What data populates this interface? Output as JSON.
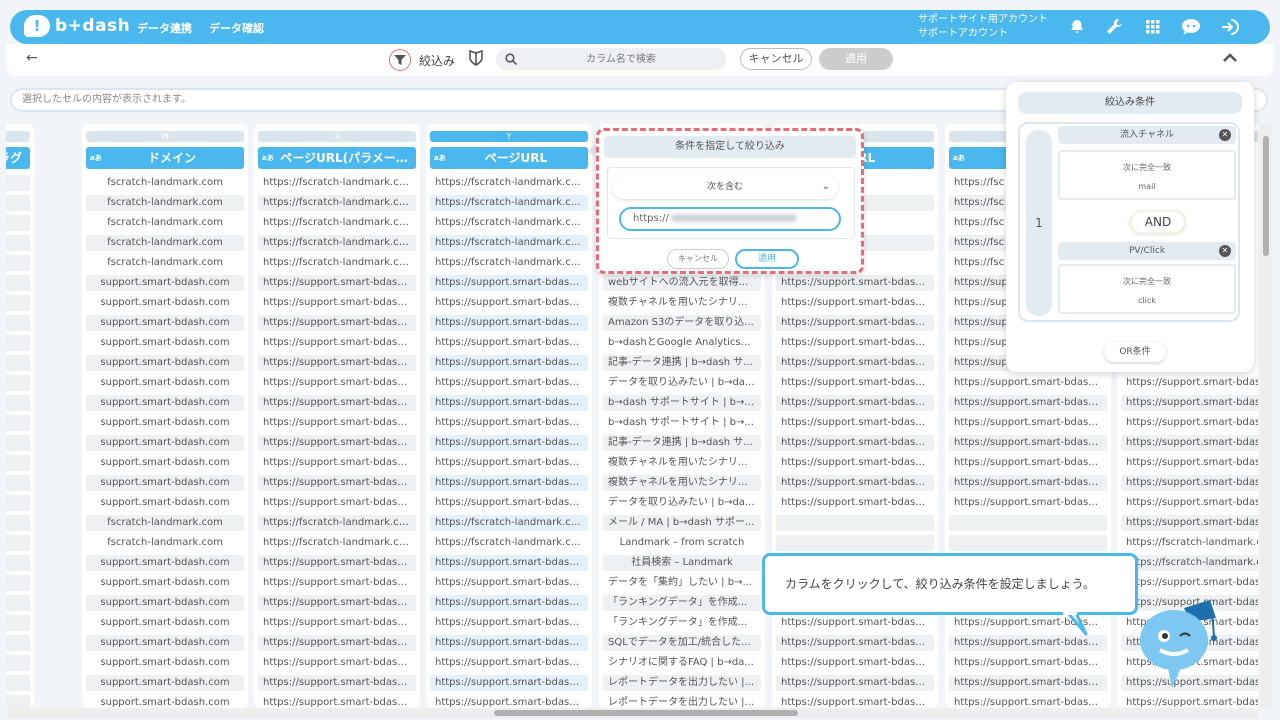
{
  "header": {
    "logo_text": "b+dash",
    "nav": [
      "データ連携",
      "データ確認"
    ],
    "account_line1": "サポートサイト用アカウント",
    "account_line2": "サポートアカウント",
    "icons": [
      "bell-icon",
      "wrench-icon",
      "grid-icon",
      "chat-icon",
      "logout-icon"
    ],
    "accent_color": "#4ab8ee"
  },
  "toolbar": {
    "back_icon": "←",
    "filter_label": "絞込み",
    "search_placeholder": "カラム名で検索",
    "cancel_label": "キャンセル",
    "apply_label": "適用"
  },
  "cell_display": {
    "placeholder": "選択したセルの内容が表示されます。"
  },
  "grid": {
    "columns": [
      {
        "letter": "",
        "header": "フラグ",
        "cells": [
          "",
          "",
          "",
          "",
          "",
          "",
          "",
          "",
          "",
          "",
          "",
          "",
          "",
          "",
          "",
          "",
          "",
          "",
          "",
          "",
          "",
          "",
          "",
          "",
          "",
          "",
          ""
        ]
      },
      {
        "letter": "W",
        "header": "ドメイン",
        "cells": [
          "fscratch-landmark.com",
          "fscratch-landmark.com",
          "fscratch-landmark.com",
          "fscratch-landmark.com",
          "fscratch-landmark.com",
          "support.smart-bdash.com",
          "support.smart-bdash.com",
          "support.smart-bdash.com",
          "support.smart-bdash.com",
          "support.smart-bdash.com",
          "support.smart-bdash.com",
          "support.smart-bdash.com",
          "support.smart-bdash.com",
          "support.smart-bdash.com",
          "support.smart-bdash.com",
          "support.smart-bdash.com",
          "support.smart-bdash.com",
          "fscratch-landmark.com",
          "fscratch-landmark.com",
          "support.smart-bdash.com",
          "support.smart-bdash.com",
          "support.smart-bdash.com",
          "support.smart-bdash.com",
          "support.smart-bdash.com",
          "support.smart-bdash.com",
          "support.smart-bdash.com",
          "support.smart-bdash.com"
        ]
      },
      {
        "letter": "X",
        "header": "ページURL(パラメー…",
        "cells": [
          "https://fscratch-landmark.co...",
          "https://fscratch-landmark.co...",
          "https://fscratch-landmark.co...",
          "https://fscratch-landmark.co...",
          "https://fscratch-landmark.co...",
          "https://support.smart-bdash...",
          "https://support.smart-bdash...",
          "https://support.smart-bdash...",
          "https://support.smart-bdash...",
          "https://support.smart-bdash...",
          "https://support.smart-bdash...",
          "https://support.smart-bdash...",
          "https://support.smart-bdash...",
          "https://support.smart-bdash...",
          "https://support.smart-bdash...",
          "https://support.smart-bdash...",
          "https://support.smart-bdash...",
          "https://fscratch-landmark.co...",
          "https://fscratch-landmark.co...",
          "https://support.smart-bdash...",
          "https://support.smart-bdash...",
          "https://support.smart-bdash...",
          "https://support.smart-bdash...",
          "https://support.smart-bdash...",
          "https://support.smart-bdash...",
          "https://support.smart-bdash...",
          "https://support.smart-bdash..."
        ]
      },
      {
        "letter": "Y",
        "header": "ページURL",
        "cells": [
          "https://fscratch-landmark.co...",
          "https://fscratch-landmark.co...",
          "https://fscratch-landmark.co...",
          "https://fscratch-landmark.co...",
          "https://fscratch-landmark.co...",
          "https://support.smart-bdash...",
          "https://support.smart-bdash...",
          "https://support.smart-bdash...",
          "https://support.smart-bdash...",
          "https://support.smart-bdash...",
          "https://support.smart-bdash...",
          "https://support.smart-bdash...",
          "https://support.smart-bdash...",
          "https://support.smart-bdash...",
          "https://support.smart-bdash...",
          "https://support.smart-bdash...",
          "https://support.smart-bdash...",
          "https://fscratch-landmark.co...",
          "https://fscratch-landmark.co...",
          "https://support.smart-bdash...",
          "https://support.smart-bdash...",
          "https://support.smart-bdash...",
          "https://support.smart-bdash...",
          "https://support.smart-bdash...",
          "https://support.smart-bdash...",
          "https://support.smart-bdash...",
          "https://support.smart-bdash..."
        ]
      },
      {
        "letter": "",
        "header": "",
        "cells": [
          "",
          "",
          "",
          "",
          "",
          "webサイトへの流入元を取得...",
          "複数チャネルを用いたシナリ...",
          "Amazon S3のデータを取り込...",
          "b→dashとGoogle Analyticsの...",
          "記事-データ連携 | b→dash サ...",
          "データを取り込みたい | b→da...",
          "b→dash サポートサイト | b→...",
          "b→dash サポートサイト | b→...",
          "記事-データ連携 | b→dash サ...",
          "複数チャネルを用いたシナリ...",
          "複数チャネルを用いたシナリ...",
          "データを取り込みたい | b→da...",
          "メール / MA | b→dash サポー...",
          "Landmark – from scratch",
          "社員検索 – Landmark",
          "データを「集約」したい | b→...",
          "「ランキングデータ」を作成...",
          "「ランキングデータ」を作成...",
          "SQLでデータを加工/統合した...",
          "シナリオに関するFAQ | b→da...",
          "レポートデータを出力したい |...",
          "レポートデータを出力したい |..."
        ]
      },
      {
        "letter": "",
        "header": "URL",
        "cells": [
          "ndmark.co...",
          "ndmark.co...",
          "ndmark.co...",
          "ndmark.co...",
          "ndmark.co...",
          "https://support.smart-bdash...",
          "https://support.smart-bdash...",
          "https://support.smart-bdash...",
          "https://support.smart-bdash...",
          "https://support.smart-bdash...",
          "https://support.smart-bdash...",
          "https://support.smart-bdash...",
          "https://support.smart-bdash...",
          "https://support.smart-bdash...",
          "https://support.smart-bdash...",
          "https://support.smart-bdash...",
          "https://support.smart-bdash...",
          "",
          "",
          "",
          "",
          "",
          "https://support.smart-bdash...",
          "https://support.smart-bdash...",
          "https://support.smart-bdash...",
          "https://support.smart-bdash...",
          "https://support.smart-bdash..."
        ]
      },
      {
        "letter": "",
        "header": "前ページ",
        "cells": [
          "https://fsc",
          "https://fsc",
          "https://fsc",
          "https://fsc",
          "https://fsc",
          "https://sup",
          "https://sup",
          "https://sup",
          "https://sup",
          "https://sup",
          "https://support.smart-bdash...",
          "https://support.smart-bdash...",
          "https://support.smart-bdash...",
          "https://support.smart-bdash...",
          "https://support.smart-bdash...",
          "https://support.smart-bdash...",
          "https://support.smart-bdash...",
          "",
          "",
          "",
          "",
          "",
          "https://support.smart-bdash...",
          "https://support.smart-bdash...",
          "https://support.smart-bdash...",
          "https://support.smart-bdash...",
          "https://support.smart-bdash..."
        ]
      },
      {
        "letter": "",
        "header": "",
        "cells": [
          "",
          "",
          "",
          "",
          "",
          "",
          "",
          "",
          "",
          "",
          "https://support.smart-bdasl",
          "https://support.smart-bdasl",
          "https://support.smart-bdasl",
          "https://support.smart-bdasl",
          "https://support.smart-bdasl",
          "https://support.smart-bdasl",
          "https://support.smart-bdasl",
          "https://support.smart-bdasl",
          "https://fscratch-landmark.c",
          "https://fscratch-landmark.c",
          "https://support.smart-bdasl",
          "https://support.smart-bdasl",
          "https://support.smart-bdasl",
          "https://support.smart-bdasl",
          "https://support.smart-bdasl",
          "https://support.smart-bdasl",
          "https://support.smart-bdasl"
        ]
      }
    ]
  },
  "popup": {
    "title": "条件を指定して絞り込み",
    "select_value": "次を含む",
    "input_value": "https://",
    "cancel_label": "キャンセル",
    "apply_label": "適用"
  },
  "conditions": {
    "title": "絞込み条件",
    "group_number": "1",
    "items": [
      {
        "name": "流入チャネル",
        "operator": "次に完全一致",
        "value": "mail"
      },
      {
        "name": "PV/Click",
        "operator": "次に完全一致",
        "value": "click"
      }
    ],
    "and_label": "AND",
    "or_label": "OR条件"
  },
  "tooltip": {
    "text": "カラムをクリックして、絞り込み条件を設定しましょう。"
  }
}
